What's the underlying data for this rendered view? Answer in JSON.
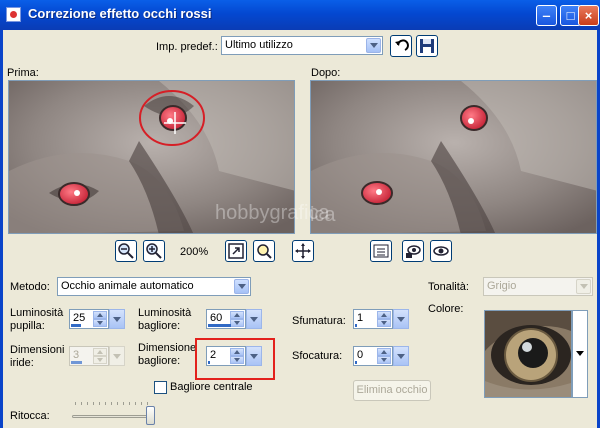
{
  "window": {
    "title": "Correzione effetto occhi rossi"
  },
  "preset": {
    "label": "Imp. predef.:",
    "value": "Ultimo utilizzo"
  },
  "before": {
    "label": "Prima:"
  },
  "after": {
    "label": "Dopo:"
  },
  "preview_watermark": "hobbygrafica",
  "zoom": {
    "value": "200%"
  },
  "method": {
    "label": "Metodo:",
    "value": "Occhio animale automatico"
  },
  "tonality": {
    "label": "Tonalità:",
    "value": "Grigio"
  },
  "color": {
    "label": "Colore:"
  },
  "pupil_lightness": {
    "label": "Luminosità pupilla:",
    "value": "25",
    "level": 0.25
  },
  "glint_lightness": {
    "label": "Luminosità bagliore:",
    "value": "60",
    "level": 0.6
  },
  "feather": {
    "label": "Sfumatura:",
    "value": "1",
    "level": 0.04
  },
  "iris_size": {
    "label": "Dimensioni iride:",
    "value": "3",
    "level": 0.3
  },
  "glint_size": {
    "label": "Dimensione bagliore:",
    "value": "2",
    "level": 0.02
  },
  "blur": {
    "label": "Sfocatura:",
    "value": "0",
    "level": 0.0
  },
  "center_glint": {
    "label": "Bagliore centrale",
    "checked": false
  },
  "remove_eye": {
    "label": "Elimina occhio"
  },
  "refine": {
    "label": "Ritocca:",
    "level": 1.0
  },
  "colors": {
    "title_bar": "#0448d1",
    "window_bg": "#ece9d8",
    "accent": "#316ac5",
    "highlight": "#e3211c",
    "eye_red": "#d8404f"
  }
}
